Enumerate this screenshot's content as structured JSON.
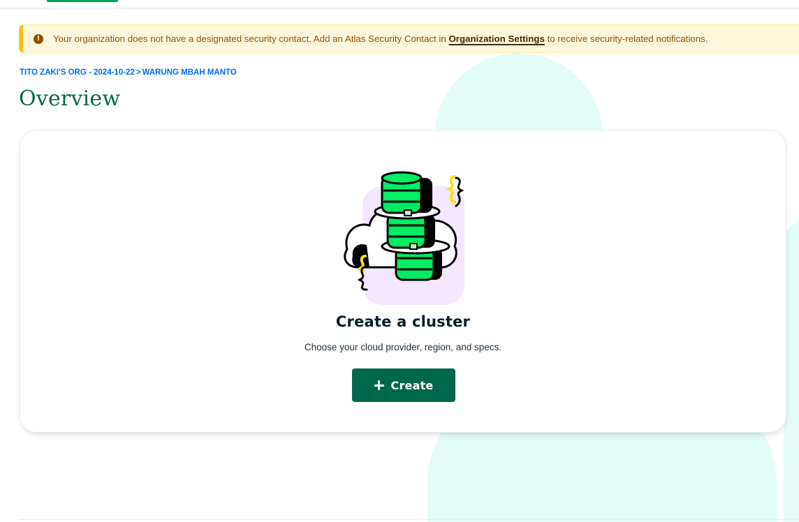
{
  "banner": {
    "text_before": "Your organization does not have a designated security contact. Add an Atlas Security Contact in ",
    "link_label": "Organization Settings",
    "text_after": " to receive security-related notifications.",
    "icon": "warning-icon"
  },
  "breadcrumb": {
    "org": "TITO ZAKI'S ORG - 2024-10-22",
    "separator": ">",
    "project": "WARUNG MBAH MANTO"
  },
  "page": {
    "title": "Overview"
  },
  "empty_state": {
    "title": "Create a cluster",
    "subtitle": "Choose your cloud provider, region, and specs.",
    "button_label": "Create",
    "button_icon": "plus-icon",
    "illustration": "database-cluster-illustration"
  },
  "colors": {
    "brand_green": "#00684a",
    "accent_green": "#00ed64",
    "link_blue": "#016bf8",
    "warning_bg": "#fef7db",
    "warning_border": "#ffc010",
    "deco_mint": "#e3fcf7"
  }
}
